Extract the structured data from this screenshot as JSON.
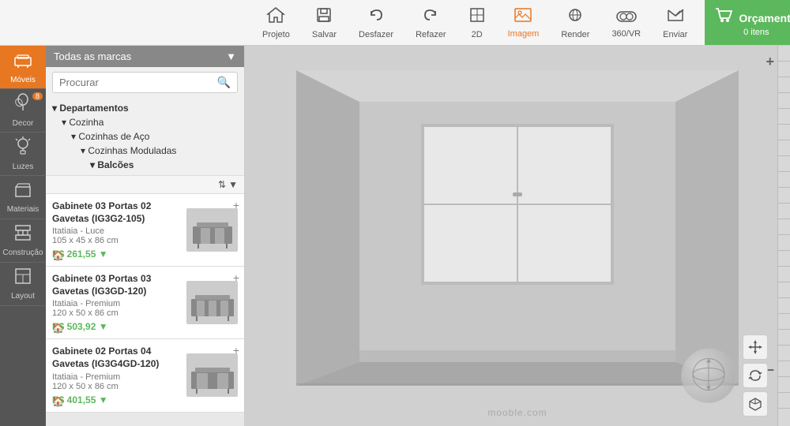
{
  "toolbar": {
    "brand_dropdown": "Todas as marcas",
    "search_placeholder": "Procurar",
    "items": [
      {
        "id": "projeto",
        "label": "Projeto",
        "icon": "🏠"
      },
      {
        "id": "salvar",
        "label": "Salvar",
        "icon": "💾"
      },
      {
        "id": "desfazer",
        "label": "Desfazer",
        "icon": "↩"
      },
      {
        "id": "refazer",
        "label": "Refazer",
        "icon": "↪"
      },
      {
        "id": "2d",
        "label": "2D",
        "icon": "⬜"
      },
      {
        "id": "imagem",
        "label": "Imagem",
        "icon": "🖼"
      },
      {
        "id": "render",
        "label": "Render",
        "icon": "🎨"
      },
      {
        "id": "360vr",
        "label": "360/VR",
        "icon": "🥽"
      },
      {
        "id": "enviar",
        "label": "Enviar",
        "icon": "✈"
      }
    ],
    "cart_label": "Orçamento",
    "cart_sub": "0 itens"
  },
  "sidebar": {
    "nav_items": [
      {
        "id": "moveis",
        "label": "Móveis",
        "icon": "🪑",
        "active": true
      },
      {
        "id": "decor",
        "label": "Decor",
        "icon": "🌿",
        "count": "8"
      },
      {
        "id": "luzes",
        "label": "Luzes",
        "icon": "💡"
      },
      {
        "id": "materiais",
        "label": "Materiais",
        "icon": "🪨"
      },
      {
        "id": "construcao",
        "label": "Construção",
        "icon": "🧱"
      },
      {
        "id": "layout",
        "label": "Layout",
        "icon": "📐"
      }
    ],
    "categories": [
      {
        "level": 0,
        "label": "Departamentos",
        "prefix": "▾ "
      },
      {
        "level": 1,
        "label": "Cozinha",
        "prefix": "▾ "
      },
      {
        "level": 2,
        "label": "Cozinhas de Aço",
        "prefix": "▾ "
      },
      {
        "level": 3,
        "label": "Cozinhas Moduladas",
        "prefix": "▾ "
      },
      {
        "level": 4,
        "label": "Balcões",
        "prefix": "▾ "
      }
    ],
    "products": [
      {
        "name": "Gabinete 03 Portas 02 Gavetas (IG3G2-105)",
        "brand": "Itatiaia - Luce",
        "dims": "105 x 45 x 86 cm",
        "price": "R$ 261,55 ▼"
      },
      {
        "name": "Gabinete 03 Portas 03 Gavetas (IG3GD-120)",
        "brand": "Itatiaia - Premium",
        "dims": "120 x 50 x 86 cm",
        "price": "R$ 503,92 ▼"
      },
      {
        "name": "Gabinete 02 Portas 04 Gavetas (IG3G4GD-120)",
        "brand": "Itatiaia - Premium",
        "dims": "120 x 50 x 86 cm",
        "price": "R$ 401,55 ▼"
      }
    ]
  },
  "viewport": {
    "watermark": "mooble.com"
  },
  "colors": {
    "orange": "#e87722",
    "green": "#5cb85c",
    "dark_gray": "#555555",
    "mid_gray": "#888888"
  }
}
